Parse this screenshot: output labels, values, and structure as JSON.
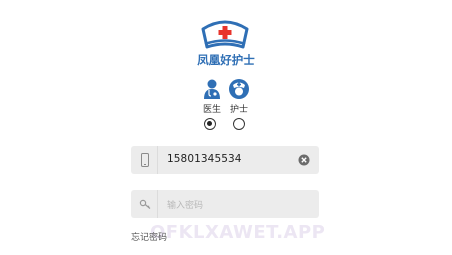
{
  "brand": {
    "name": "凤凰好护士",
    "logo_icon": "nurse-cap-logo-icon"
  },
  "roles": [
    {
      "label": "医生",
      "icon": "doctor-icon",
      "selected": true
    },
    {
      "label": "护士",
      "icon": "nurse-icon",
      "selected": false
    }
  ],
  "phone_field": {
    "icon": "phone-icon",
    "value": "15801345534",
    "clear_icon": "clear-icon"
  },
  "password_field": {
    "icon": "key-icon",
    "placeholder": "输入密码"
  },
  "forgot_password": "忘记密码",
  "watermark": "OFKLXAWET.APP",
  "colors": {
    "brand_blue": "#2f6fb5",
    "accent_red": "#e8342c",
    "field_bg": "#ececec"
  }
}
